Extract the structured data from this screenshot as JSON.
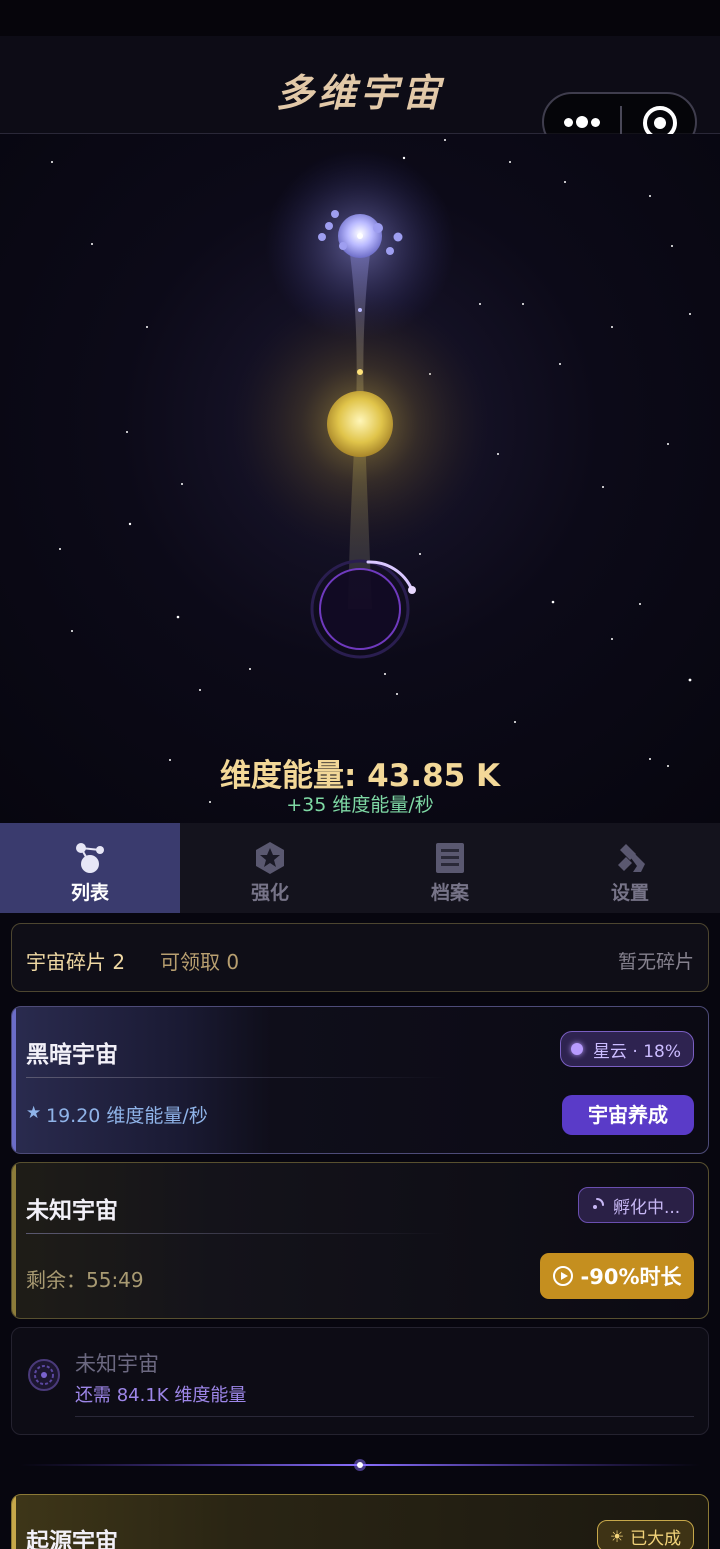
{
  "header": {
    "title": "多维宇宙"
  },
  "capsule": {
    "more_icon": "more-dots-icon",
    "close_icon": "target-circle-icon"
  },
  "energy": {
    "label": "维度能量: 43.85 K",
    "rate": "+35 维度能量/秒"
  },
  "tabs": [
    {
      "label": "列表",
      "icon": "universe-list-icon",
      "active": true
    },
    {
      "label": "强化",
      "icon": "star-badge-icon",
      "active": false
    },
    {
      "label": "档案",
      "icon": "archive-icon",
      "active": false
    },
    {
      "label": "设置",
      "icon": "tools-icon",
      "active": false
    }
  ],
  "shards": {
    "title": "宇宙碎片 2",
    "claimable": "可领取 0",
    "status": "暂无碎片"
  },
  "universes": {
    "dark": {
      "name": "黑暗宇宙",
      "badge": "星云 · 18%",
      "rate": "19.20 维度能量/秒",
      "button": "宇宙养成"
    },
    "unknown": {
      "name": "未知宇宙",
      "badge": "孵化中...",
      "remaining": "剩余：55:49",
      "button": "-90%时长"
    },
    "locked": {
      "name": "未知宇宙",
      "requirement": "还需 84.1K 维度能量"
    },
    "origin": {
      "name": "起源宇宙",
      "badge": "已大成"
    }
  },
  "colors": {
    "gold": "#f3d898",
    "green": "#7ed8a4",
    "purple": "#5a3bc8",
    "amber": "#c58f1f",
    "tab_active": "#3a3b6e"
  }
}
